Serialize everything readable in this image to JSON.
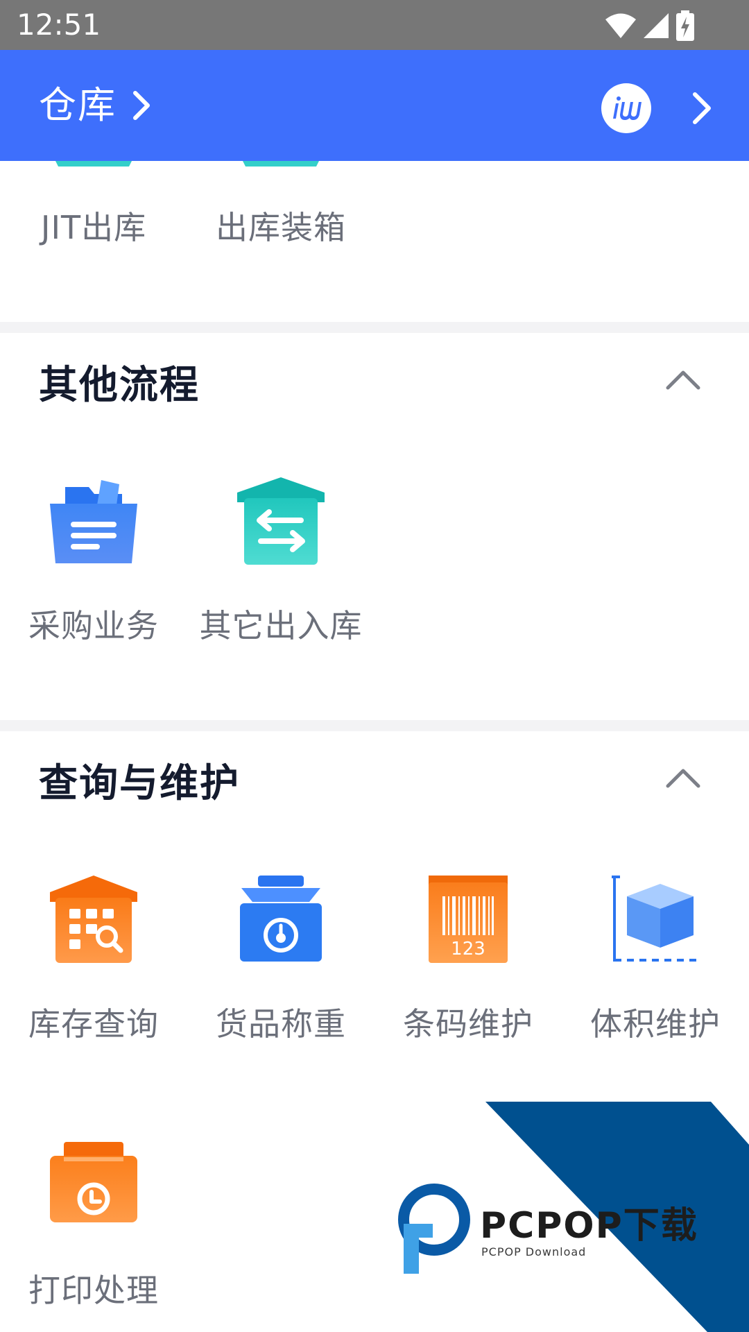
{
  "status_bar": {
    "time": "12:51",
    "icons": [
      "wifi-icon",
      "signal-icon",
      "battery-charging-icon"
    ]
  },
  "app_bar": {
    "warehouse_label": "仓库",
    "left_chevron_icon": "chevron-right-icon",
    "right_chevron_icon": "chevron-right-icon",
    "logo_icon": "brand-logo-icon"
  },
  "outbound_section": {
    "tiles": [
      {
        "label": "JIT出库",
        "icon": "jit-outbound-icon"
      },
      {
        "label": "出库装箱",
        "icon": "outbound-packing-icon"
      }
    ]
  },
  "other_process": {
    "title": "其他流程",
    "collapse_icon": "chevron-up-icon",
    "tiles": [
      {
        "label": "采购业务",
        "icon": "purchase-folder-icon"
      },
      {
        "label": "其它出入库",
        "icon": "transfer-house-icon"
      }
    ]
  },
  "query_maintenance": {
    "title": "查询与维护",
    "collapse_icon": "chevron-up-icon",
    "tiles": [
      {
        "label": "库存查询",
        "icon": "inventory-search-icon"
      },
      {
        "label": "货品称重",
        "icon": "scale-icon"
      },
      {
        "label": "条码维护",
        "icon": "barcode-icon"
      },
      {
        "label": "体积维护",
        "icon": "volume-cube-icon"
      },
      {
        "label": "打印处理",
        "icon": "printer-clock-icon"
      }
    ]
  },
  "barcode_digits": "123",
  "watermark": {
    "brand": "PCPOP下载",
    "subtitle": "PCPOP Download"
  },
  "colors": {
    "app_bar": "#3e6ffc",
    "status_bar": "#777777",
    "title_text": "#141b2e",
    "label_text": "#6b6f7a",
    "watermark_blue": "#00508f"
  }
}
